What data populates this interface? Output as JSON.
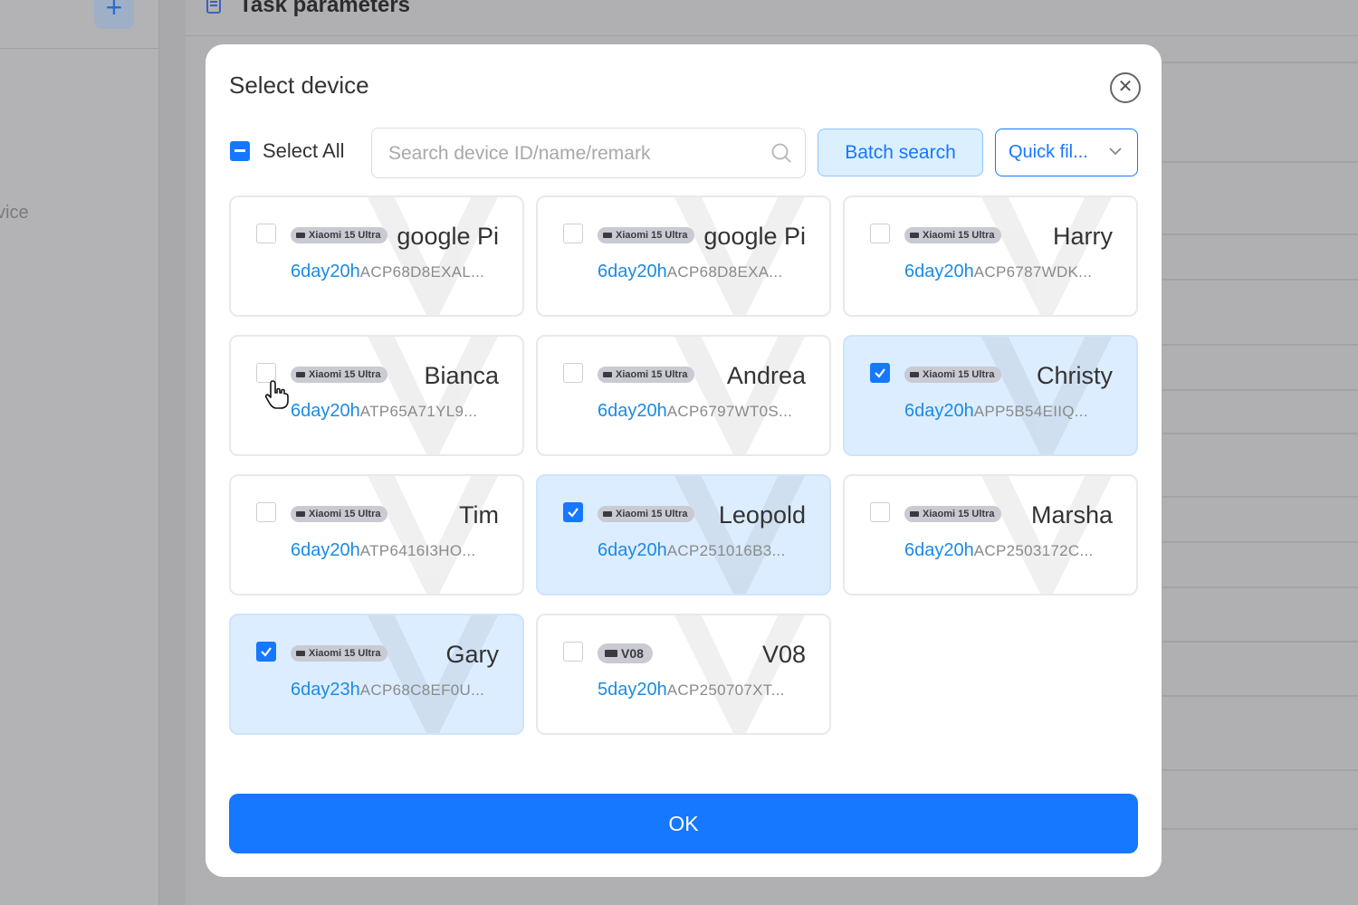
{
  "background": {
    "add_icon": "plus-icon",
    "sidebar_text": "vice",
    "header_title": "Task parameters",
    "header_icon": "document-icon"
  },
  "modal": {
    "title": "Select device",
    "close_icon": "close-icon",
    "select_all_label": "Select All",
    "select_all_state": "indeterminate",
    "search": {
      "placeholder": "Search device ID/name/remark",
      "value": ""
    },
    "batch_search_label": "Batch search",
    "quick_filter_label": "Quick fil...",
    "ok_label": "OK"
  },
  "devices": [
    {
      "model": "Xiaomi 15 Ultra",
      "name": "google Pi",
      "time": "6day20h",
      "id": "ACP68D8EXAL...",
      "checked": false
    },
    {
      "model": "Xiaomi 15 Ultra",
      "name": "google Pi",
      "time": "6day20h",
      "id": "ACP68D8EXA...",
      "checked": false
    },
    {
      "model": "Xiaomi 15 Ultra",
      "name": "Harry",
      "time": "6day20h",
      "id": "ACP6787WDK...",
      "checked": false
    },
    {
      "model": "Xiaomi 15 Ultra",
      "name": "Bianca",
      "time": "6day20h",
      "id": "ATP65A71YL9...",
      "checked": false
    },
    {
      "model": "Xiaomi 15 Ultra",
      "name": "Andrea",
      "time": "6day20h",
      "id": "ACP6797WT0S...",
      "checked": false
    },
    {
      "model": "Xiaomi 15 Ultra",
      "name": "Christy",
      "time": "6day20h",
      "id": "APP5B54EIIQ...",
      "checked": true
    },
    {
      "model": "Xiaomi 15 Ultra",
      "name": "Tim",
      "time": "6day20h",
      "id": "ATP6416I3HO...",
      "checked": false
    },
    {
      "model": "Xiaomi 15 Ultra",
      "name": "Leopold",
      "time": "6day20h",
      "id": "ACP251016B3...",
      "checked": true
    },
    {
      "model": "Xiaomi 15 Ultra",
      "name": "Marsha",
      "time": "6day20h",
      "id": "ACP2503172C...",
      "checked": false
    },
    {
      "model": "Xiaomi 15 Ultra",
      "name": "Gary",
      "time": "6day23h",
      "id": "ACP68C8EF0U...",
      "checked": true
    },
    {
      "model": "V08",
      "name": "V08",
      "time": "5day20h",
      "id": "ACP250707XT...",
      "checked": false
    }
  ],
  "colors": {
    "primary": "#1677ff",
    "selected_card": "#dcedff",
    "time_text": "#1b8ae6"
  }
}
